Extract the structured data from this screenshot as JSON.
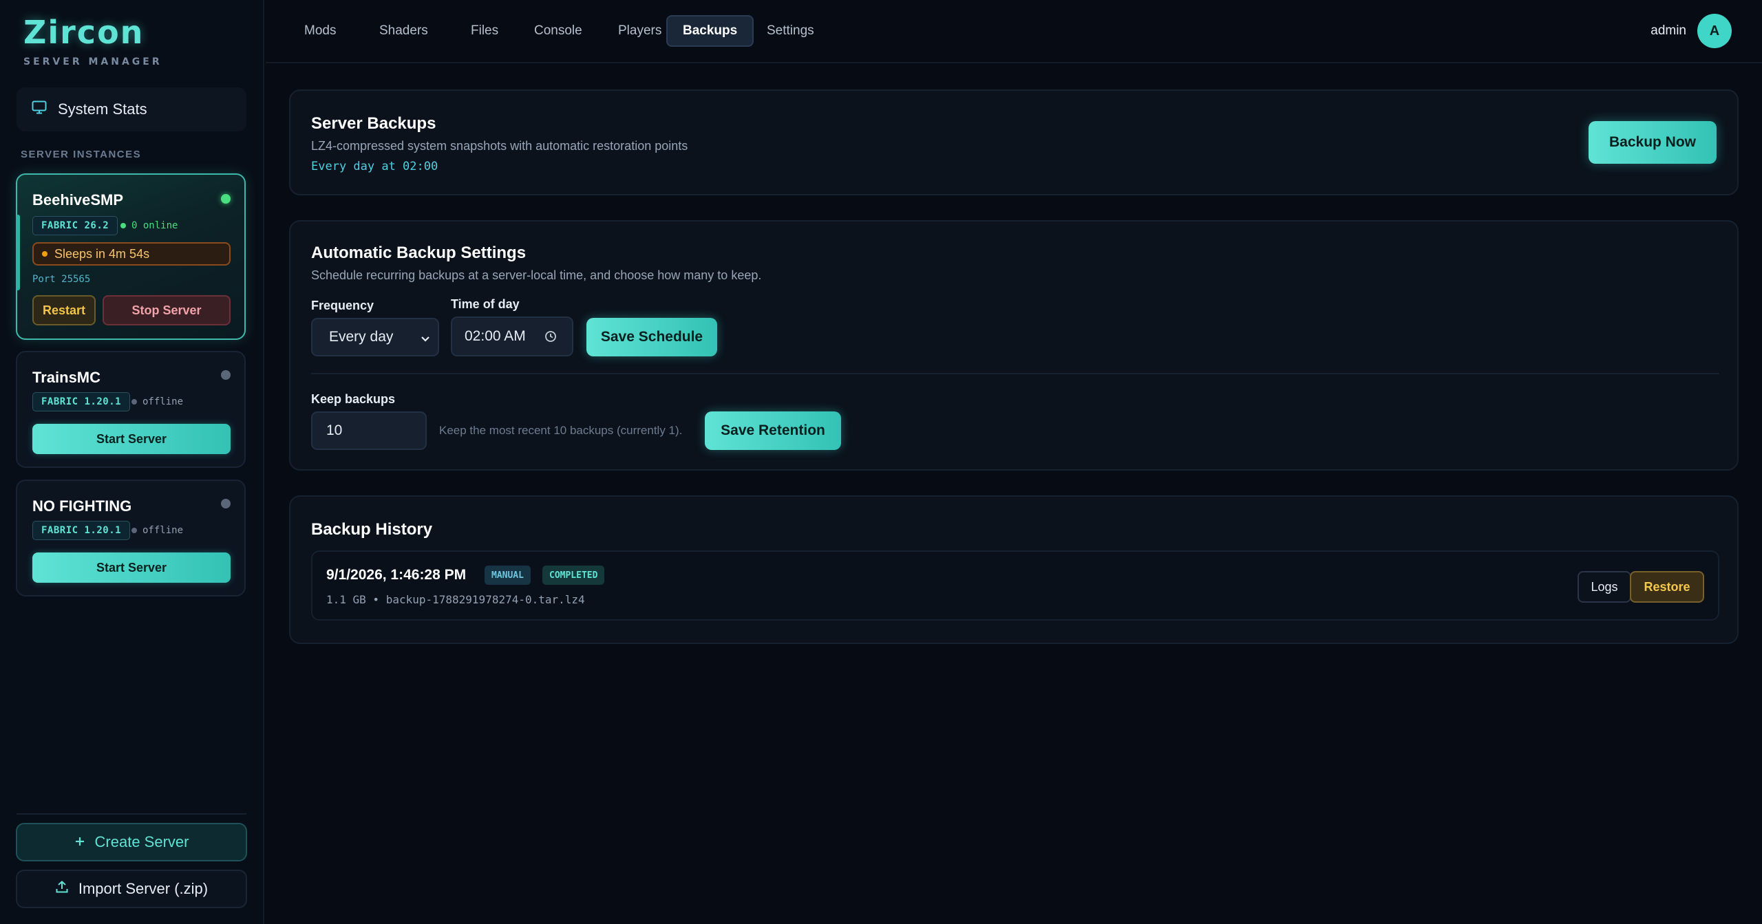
{
  "brand": {
    "name": "Zircon",
    "subtitle": "SERVER MANAGER"
  },
  "sidebar": {
    "system_stats_label": "System Stats",
    "section_label": "SERVER INSTANCES",
    "servers": [
      {
        "name": "BeehiveSMP",
        "version": "FABRIC 26.2",
        "status": "0 online",
        "status_color": "#4ade80",
        "sleep_text": "Sleeps in 4m 54s",
        "port": "Port 25565",
        "restart_label": "Restart",
        "stop_label": "Stop Server"
      },
      {
        "name": "TrainsMC",
        "version": "FABRIC 1.20.1",
        "status": "offline",
        "status_color": "#5b6678",
        "start_label": "Start Server"
      },
      {
        "name": "NO FIGHTING",
        "version": "FABRIC 1.20.1",
        "status": "offline",
        "status_color": "#5b6678",
        "start_label": "Start Server"
      }
    ],
    "create_label": "Create Server",
    "import_label": "Import Server (.zip)"
  },
  "nav": {
    "tabs": [
      "Mods",
      "Shaders",
      "Files",
      "Console",
      "Players",
      "Backups",
      "Settings"
    ],
    "active_tab": "Backups",
    "user": "admin",
    "avatar_letter": "A"
  },
  "backups_panel": {
    "title": "Server Backups",
    "subtitle": "LZ4-compressed system snapshots with automatic restoration points",
    "schedule": "Every day at 02:00",
    "backup_now_label": "Backup Now"
  },
  "settings_panel": {
    "title": "Automatic Backup Settings",
    "subtitle": "Schedule recurring backups at a server-local time, and choose how many to keep.",
    "frequency_label": "Frequency",
    "frequency_value": "Every day",
    "time_label": "Time of day",
    "time_value": "02:00 AM",
    "save_schedule_label": "Save Schedule",
    "keep_label": "Keep backups",
    "keep_value": "10",
    "keep_hint": "Keep the most recent 10 backups (currently 1).",
    "save_retention_label": "Save Retention"
  },
  "history_panel": {
    "title": "Backup History",
    "items": [
      {
        "date": "9/1/2026, 1:46:28 PM",
        "type_tag": "MANUAL",
        "status_tag": "COMPLETED",
        "meta": "1.1 GB • backup-1788291978274-0.tar.lz4",
        "logs_label": "Logs",
        "restore_label": "Restore"
      }
    ]
  },
  "colors": {
    "accent": "#40e0d0",
    "background": "#070c14",
    "panel": "#0b121c",
    "warning": "#f2c44b",
    "danger": "#f2a3a8"
  }
}
